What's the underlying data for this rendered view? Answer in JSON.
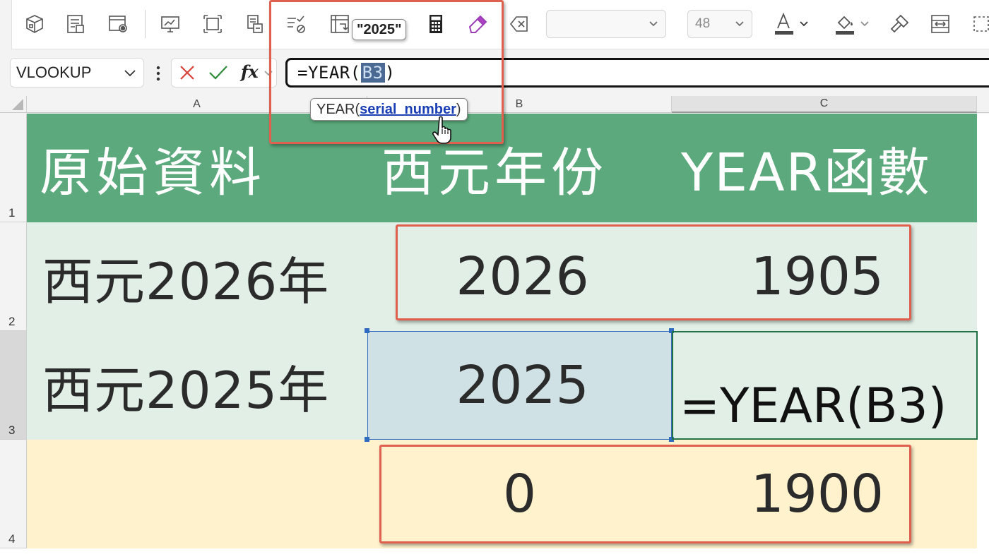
{
  "ribbon": {
    "font_size_value": "48",
    "font_name_value": "",
    "value_tooltip": "\"2025\"",
    "icons": [
      "3d-model-icon",
      "form-icon",
      "record-macro-icon",
      "screen-icon",
      "select-objects-icon",
      "document-inspect-icon",
      "clear-validation-icon",
      "pivot-layout-icon",
      "calculator-icon",
      "eraser-icon",
      "clear-tag-icon",
      "font-color-icon",
      "fill-color-icon",
      "format-painter-icon",
      "column-width-icon",
      "more-icon"
    ]
  },
  "formula_bar": {
    "name_box": "VLOOKUP",
    "formula_prefix": "=YEAR(",
    "formula_ref": "B3",
    "formula_suffix": ")",
    "fx_label": "fx"
  },
  "function_tooltip": {
    "func": "YEAR(",
    "arg": "serial_number",
    "close": ")"
  },
  "columns": [
    "A",
    "B",
    "C"
  ],
  "rows": [
    "1",
    "2",
    "3",
    "4"
  ],
  "cells": {
    "A1": "原始資料",
    "B1": "西元年份",
    "C1": "YEAR函數",
    "A2": "西元2026年",
    "B2": "2026",
    "C2": "1905",
    "A3": "西元2025年",
    "B3": "2025",
    "C3": "=YEAR(B3)",
    "A4": "",
    "B4": "0",
    "C4": "1900"
  },
  "colors": {
    "header_band": "#5ba97c",
    "row_band": "#e1efe6",
    "row4_band": "#fff2cc",
    "annotation_red": "#e0604f",
    "selection_blue": "#2f6bbf",
    "active_green": "#217346"
  }
}
